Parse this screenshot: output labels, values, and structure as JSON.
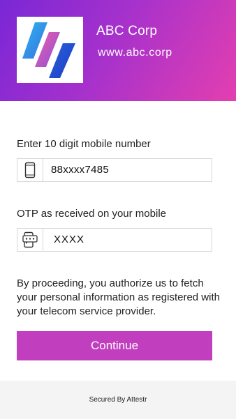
{
  "brand": {
    "name": "ABC Corp",
    "url": "www.abc.corp",
    "logo_icon": "abc-corp-logo",
    "gradient": [
      "#7a27d6",
      "#e33fb0"
    ]
  },
  "form": {
    "mobile_label": "Enter 10 digit mobile number",
    "mobile_value": "88xxxx7485",
    "mobile_icon": "mobile-phone-icon",
    "otp_label": "OTP as received on your mobile",
    "otp_value": "XXXX",
    "otp_icon": "otp-message-icon"
  },
  "consent_text": "By proceeding, you authorize us to fetch your personal information as registered with your telecom service provider.",
  "continue_label": "Continue",
  "accent_color": "#c13fbf",
  "footer": {
    "text": "Secured By Attestr"
  }
}
